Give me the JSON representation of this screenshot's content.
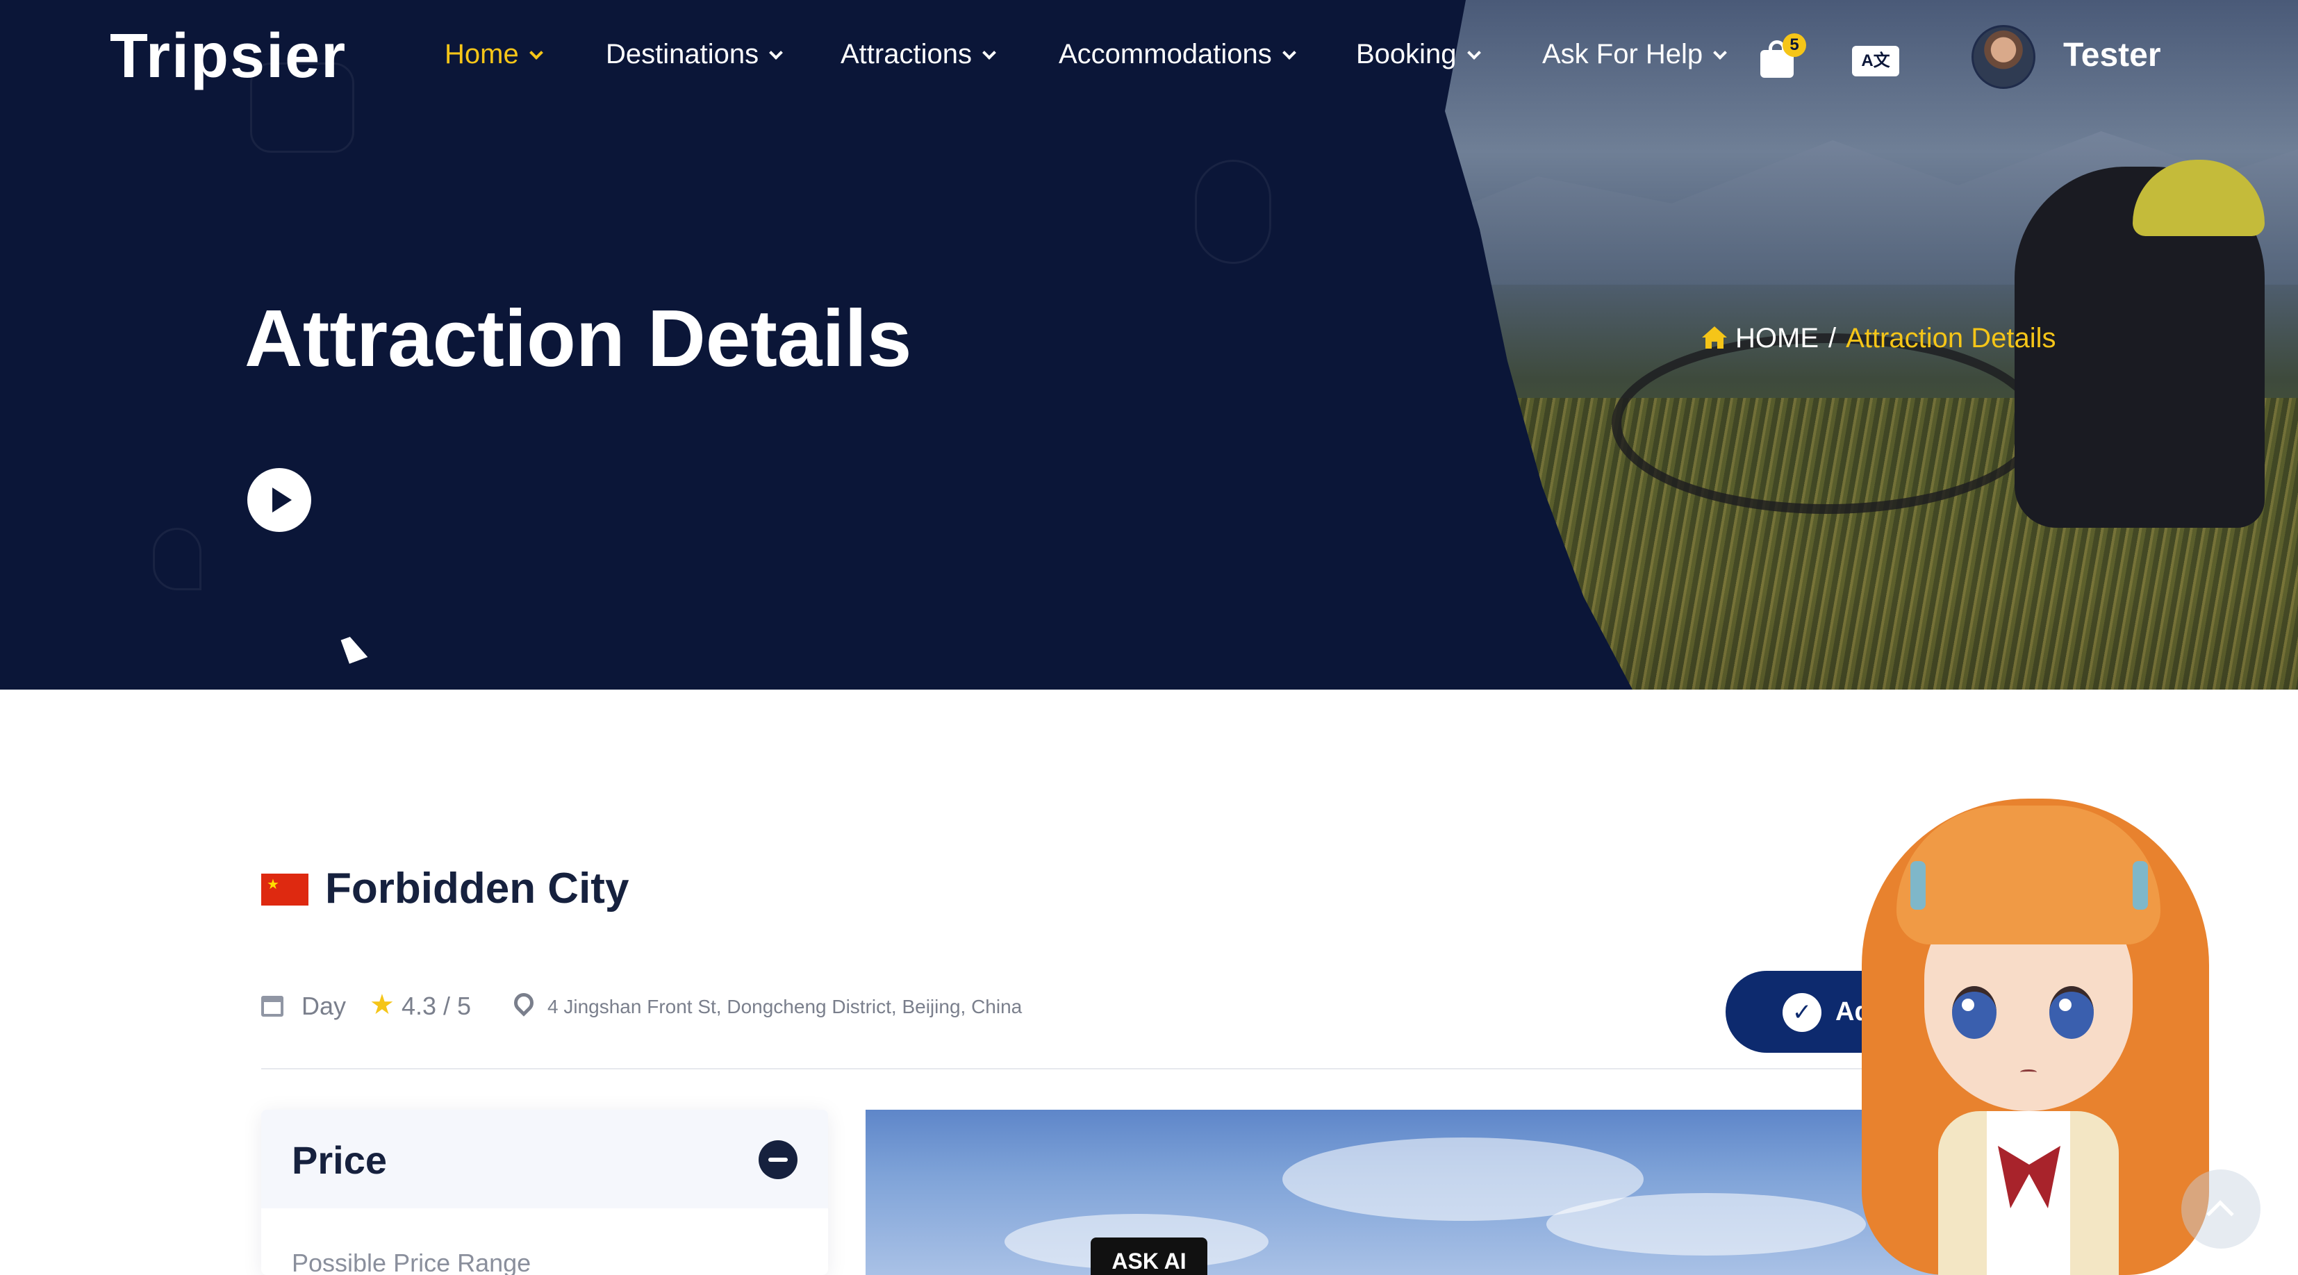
{
  "brand": {
    "logo_text": "Tripsier"
  },
  "nav": {
    "items": [
      {
        "label": "Home",
        "active": true
      },
      {
        "label": "Destinations",
        "active": false
      },
      {
        "label": "Attractions",
        "active": false
      },
      {
        "label": "Accommodations",
        "active": false
      },
      {
        "label": "Booking",
        "active": false
      },
      {
        "label": "Ask For Help",
        "active": false
      }
    ],
    "cart_count": "5",
    "lang_icon_text": "A文",
    "user_name": "Tester"
  },
  "hero": {
    "title": "Attraction Details",
    "breadcrumb": {
      "home": "HOME",
      "separator": "/",
      "current": "Attraction Details"
    }
  },
  "attraction": {
    "name": "Forbidden City",
    "flag": "China",
    "time": "Day",
    "rating": "4.3 / 5",
    "address": "4 Jingshan Front St, Dongcheng District, Beijing, China",
    "add_button_label": "Ad"
  },
  "price": {
    "title": "Price",
    "range_label": "Possible Price Range"
  },
  "ask_ai_label": "ASK AI",
  "colors": {
    "hero_bg": "#0b1638",
    "accent": "#f5c518",
    "button": "#0d2a6e"
  }
}
